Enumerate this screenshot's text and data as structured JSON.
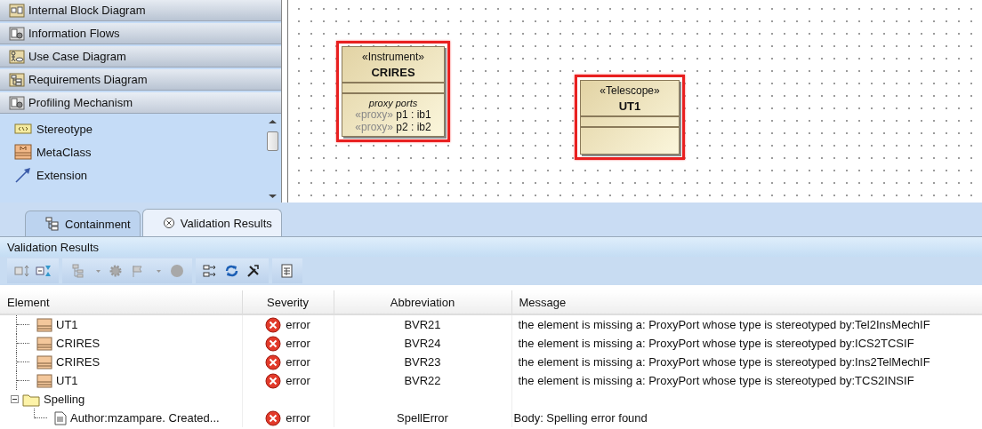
{
  "palette": {
    "groups": [
      {
        "label": "Internal Block Diagram",
        "kind": "ibd",
        "expanded": false
      },
      {
        "label": "Information Flows",
        "kind": "profile",
        "expanded": false
      },
      {
        "label": "Use Case Diagram",
        "kind": "usecase",
        "expanded": false
      },
      {
        "label": "Requirements Diagram",
        "kind": "requirements",
        "expanded": false
      },
      {
        "label": "Profiling Mechanism",
        "kind": "profile",
        "expanded": true
      }
    ],
    "items": [
      {
        "label": "Stereotype",
        "kind": "stereotype"
      },
      {
        "label": "MetaClass",
        "kind": "metaclass"
      },
      {
        "label": "Extension",
        "kind": "extension"
      }
    ]
  },
  "diagram": {
    "blocks": [
      {
        "stereotype": "«Instrument»",
        "name": "CRIRES",
        "selected": true,
        "compartment_title": "proxy ports",
        "ports": [
          {
            "stereotype": "«proxy»",
            "name": "p1 : ib1"
          },
          {
            "stereotype": "«proxy»",
            "name": "p2 : ib2"
          }
        ]
      },
      {
        "stereotype": "«Telescope»",
        "name": "UT1",
        "selected": true
      }
    ]
  },
  "tabs": [
    {
      "label": "Containment",
      "kind": "containment",
      "selected": false
    },
    {
      "label": "Validation Results",
      "kind": "validation",
      "selected": true
    }
  ],
  "panel": {
    "title": "Validation Results"
  },
  "results": {
    "columns": [
      "Element",
      "Severity",
      "Abbreviation",
      "Message"
    ],
    "rows": [
      {
        "element": "UT1",
        "kind": "block",
        "severity": "error",
        "abbreviation": "BVR21",
        "message": "the element is missing a: ProxyPort whose type is stereotyped by:Tel2InsMechIF"
      },
      {
        "element": "CRIRES",
        "kind": "block",
        "severity": "error",
        "abbreviation": "BVR24",
        "message": "the element is missing a: ProxyPort whose type is stereotyped by:ICS2TCSIF"
      },
      {
        "element": "CRIRES",
        "kind": "block",
        "severity": "error",
        "abbreviation": "BVR23",
        "message": "the element is missing a: ProxyPort whose type is stereotyped by:Ins2TelMechIF"
      },
      {
        "element": "UT1",
        "kind": "block",
        "severity": "error",
        "abbreviation": "BVR22",
        "message": "the element is missing a: ProxyPort whose type is stereotyped by:TCS2INSIF"
      },
      {
        "element": "Spelling",
        "kind": "folder",
        "expanded": true,
        "children": [
          {
            "element": "Author:mzampare. Created...",
            "kind": "comment",
            "severity": "error",
            "abbreviation": "SpellError",
            "message": "Body: Spelling error found"
          }
        ]
      }
    ]
  }
}
